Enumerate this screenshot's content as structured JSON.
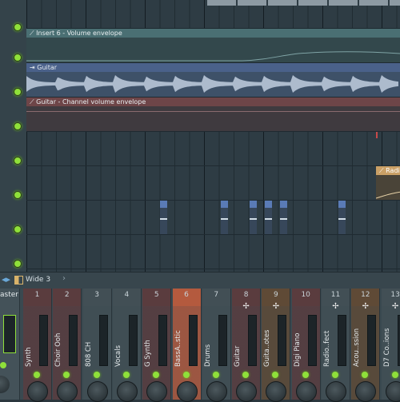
{
  "playlist": {
    "clips": {
      "insert6": "Insert 6 - Volume envelope",
      "guitar": "Guitar",
      "guitar_env": "Guitar - Channel volume envelope",
      "radio": "Radi"
    },
    "colors": {
      "green_led": "#8fe03a",
      "audio_clip": "#3e5168",
      "env_teal": "#3f5f63",
      "env_red": "#6e4548",
      "radio_clip": "#caa066"
    }
  },
  "toolbar": {
    "arrow_icon": "arrow-left-right-icon",
    "preset": "Wide 3",
    "chevron": "›"
  },
  "mixer": {
    "master_label": "aster",
    "channels": [
      {
        "num": "1",
        "name": "Synth",
        "color": "#5a3c3e",
        "route": ""
      },
      {
        "num": "2",
        "name": "Choir Ooh",
        "color": "#5a3c3e",
        "route": ""
      },
      {
        "num": "3",
        "name": "808 CH",
        "color": "#424f55",
        "route": ""
      },
      {
        "num": "4",
        "name": "Vocals",
        "color": "#424f55",
        "route": ""
      },
      {
        "num": "5",
        "name": "G Synth",
        "color": "#5a3c3e",
        "route": ""
      },
      {
        "num": "6",
        "name": "BassA..stic",
        "color": "#b45a3e",
        "route": ""
      },
      {
        "num": "7",
        "name": "Drums",
        "color": "#424f55",
        "route": ""
      },
      {
        "num": "8",
        "name": "Guitar",
        "color": "#5a3c3e",
        "route": "✢"
      },
      {
        "num": "9",
        "name": "Guita..otes",
        "color": "#5f4a36",
        "route": "✢"
      },
      {
        "num": "10",
        "name": "Digi Piano",
        "color": "#5a3c3e",
        "route": ""
      },
      {
        "num": "11",
        "name": "Radio..fect",
        "color": "#424f55",
        "route": "✢"
      },
      {
        "num": "12",
        "name": "Acou..ssion",
        "color": "#5f4a36",
        "route": "✢"
      },
      {
        "num": "13",
        "name": "D7 Co..ions",
        "color": "#424f55",
        "route": "✢"
      }
    ]
  }
}
